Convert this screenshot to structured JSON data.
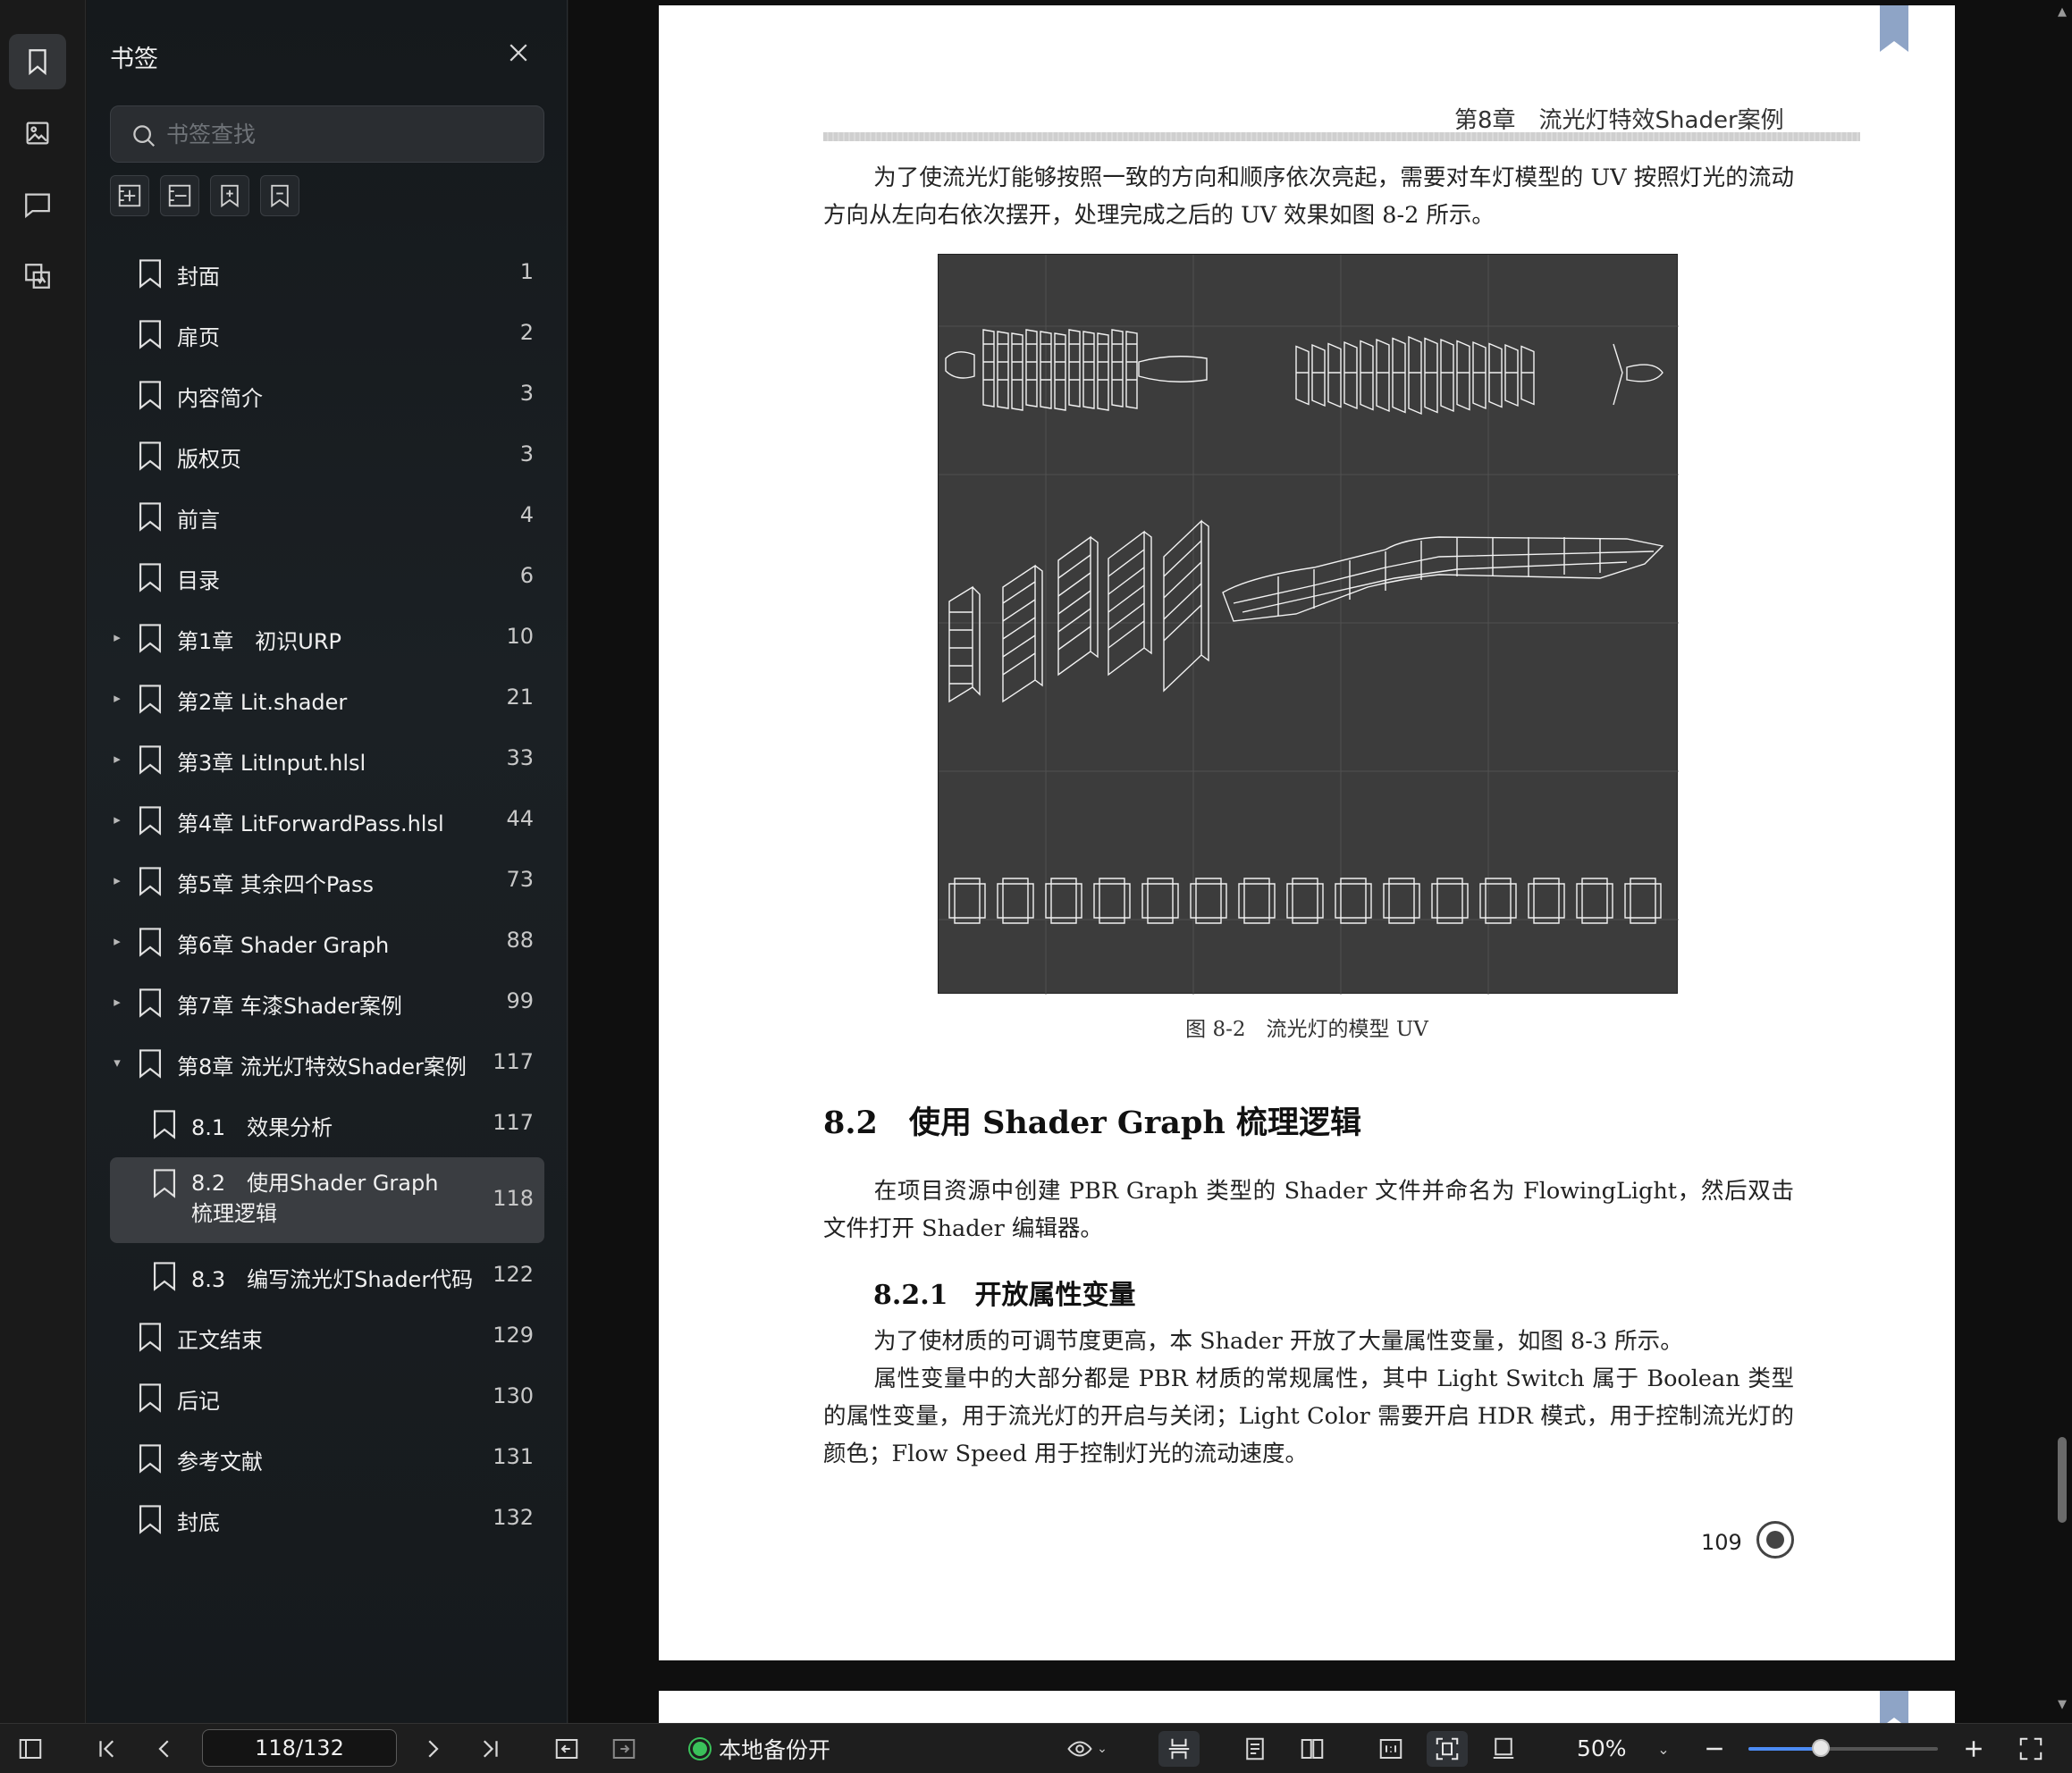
{
  "rail": {
    "items": [
      {
        "name": "bookmark-tab",
        "icon": "bookmark-icon",
        "active": true
      },
      {
        "name": "thumbnail-tab",
        "icon": "image-icon",
        "active": false
      },
      {
        "name": "comment-tab",
        "icon": "comment-icon",
        "active": false
      },
      {
        "name": "attachment-tab",
        "icon": "attachment-icon",
        "active": false
      }
    ]
  },
  "panel": {
    "title": "书签",
    "search_placeholder": "书签查找",
    "bookmarks": [
      {
        "label": "封面",
        "page": "1",
        "level": 0,
        "expand": ""
      },
      {
        "label": "扉页",
        "page": "2",
        "level": 0,
        "expand": ""
      },
      {
        "label": "内容简介",
        "page": "3",
        "level": 0,
        "expand": ""
      },
      {
        "label": "版权页",
        "page": "3",
        "level": 0,
        "expand": ""
      },
      {
        "label": "前言",
        "page": "4",
        "level": 0,
        "expand": ""
      },
      {
        "label": "目录",
        "page": "6",
        "level": 0,
        "expand": ""
      },
      {
        "label": "第1章　初识URP",
        "page": "10",
        "level": 0,
        "expand": "▸"
      },
      {
        "label": "第2章 Lit.shader",
        "page": "21",
        "level": 0,
        "expand": "▸"
      },
      {
        "label": "第3章 LitInput.hlsl",
        "page": "33",
        "level": 0,
        "expand": "▸"
      },
      {
        "label": "第4章 LitForwardPass.hlsl",
        "page": "44",
        "level": 0,
        "expand": "▸"
      },
      {
        "label": "第5章 其余四个Pass",
        "page": "73",
        "level": 0,
        "expand": "▸"
      },
      {
        "label": "第6章 Shader Graph",
        "page": "88",
        "level": 0,
        "expand": "▸"
      },
      {
        "label": "第7章 车漆Shader案例",
        "page": "99",
        "level": 0,
        "expand": "▸"
      },
      {
        "label": "第8章 流光灯特效Shader案例",
        "page": "117",
        "level": 0,
        "expand": "▾"
      },
      {
        "label": "8.1　效果分析",
        "page": "117",
        "level": 1,
        "expand": ""
      },
      {
        "label": "8.2　使用Shader Graph梳理逻辑",
        "page": "118",
        "level": 1,
        "expand": "",
        "selected": true
      },
      {
        "label": "8.3　编写流光灯Shader代码",
        "page": "122",
        "level": 1,
        "expand": ""
      },
      {
        "label": "正文结束",
        "page": "129",
        "level": 0,
        "expand": ""
      },
      {
        "label": "后记",
        "page": "130",
        "level": 0,
        "expand": ""
      },
      {
        "label": "参考文献",
        "page": "131",
        "level": 0,
        "expand": ""
      },
      {
        "label": "封底",
        "page": "132",
        "level": 0,
        "expand": ""
      }
    ]
  },
  "document": {
    "running_head": "第8章　流光灯特效Shader案例",
    "para1": "为了使流光灯能够按照一致的方向和顺序依次亮起，需要对车灯模型的 UV 按照灯光的流动方向从左向右依次摆开，处理完成之后的 UV 效果如图 8-2 所示。",
    "figure_caption": "图 8-2　流光灯的模型 UV",
    "section_title": "8.2　使用 Shader Graph 梳理逻辑",
    "para2": "在项目资源中创建 PBR Graph 类型的 Shader 文件并命名为 FlowingLight，然后双击文件打开 Shader 编辑器。",
    "subsection_title": "8.2.1　开放属性变量",
    "para3": "为了使材质的可调节度更高，本 Shader 开放了大量属性变量，如图 8-3 所示。",
    "para4": "属性变量中的大部分都是 PBR 材质的常规属性，其中 Light Switch 属于 Boolean 类型的属性变量，用于流光灯的开启与关闭；Light Color 需要开启 HDR 模式，用于控制流光灯的颜色；Flow Speed 用于控制灯光的流动速度。",
    "page_number": "109"
  },
  "toolbar": {
    "page_indicator": "118/132",
    "backup_label": "本地备份开",
    "zoom": "50%",
    "zoom_fraction": 0.5
  },
  "colors": {
    "accent": "#4d8cf5",
    "backup_status": "#3ac15a",
    "bookmark_ribbon": "#8ea4c6"
  }
}
